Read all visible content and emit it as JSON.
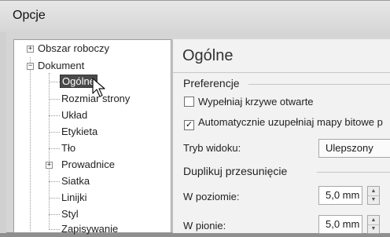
{
  "window": {
    "title": "Opcje"
  },
  "tree": {
    "items": [
      {
        "label": "Obszar roboczy",
        "expander": "+"
      },
      {
        "label": "Dokument",
        "expander": "−"
      },
      {
        "label": "Ogólne"
      },
      {
        "label": "Rozmiar strony"
      },
      {
        "label": "Układ"
      },
      {
        "label": "Etykieta"
      },
      {
        "label": "Tło"
      },
      {
        "label": "Prowadnice",
        "expander": "+"
      },
      {
        "label": "Siatka"
      },
      {
        "label": "Linijki"
      },
      {
        "label": "Styl"
      },
      {
        "label": "Zapisywanie"
      }
    ],
    "selected": "Ogólne"
  },
  "panel": {
    "title": "Ogólne",
    "preferences": {
      "heading": "Preferencje",
      "option1": {
        "label": "Wypełniaj krzywe otwarte",
        "checked": false
      },
      "option2": {
        "label": "Automatycznie uzupełniaj mapy bitowe p",
        "checked": true
      }
    },
    "view_mode": {
      "label": "Tryb widoku:",
      "value": "Ulepszony"
    },
    "duplicate": {
      "heading": "Duplikuj przesunięcie",
      "horizontal": {
        "label": "W poziomie:",
        "value": "5,0 mm"
      },
      "vertical": {
        "label": "W pionie:",
        "value": "5,0 mm"
      }
    }
  },
  "icons": {
    "expander_plus": "plus-box-icon",
    "expander_minus": "minus-box-icon",
    "cursor": "mouse-pointer-icon",
    "spin_up": "triangle-up-icon",
    "spin_down": "triangle-down-icon",
    "check": "checkmark-icon"
  },
  "colors": {
    "selection": "#4a4a4a",
    "panel_bg": "#f2f2f2"
  }
}
